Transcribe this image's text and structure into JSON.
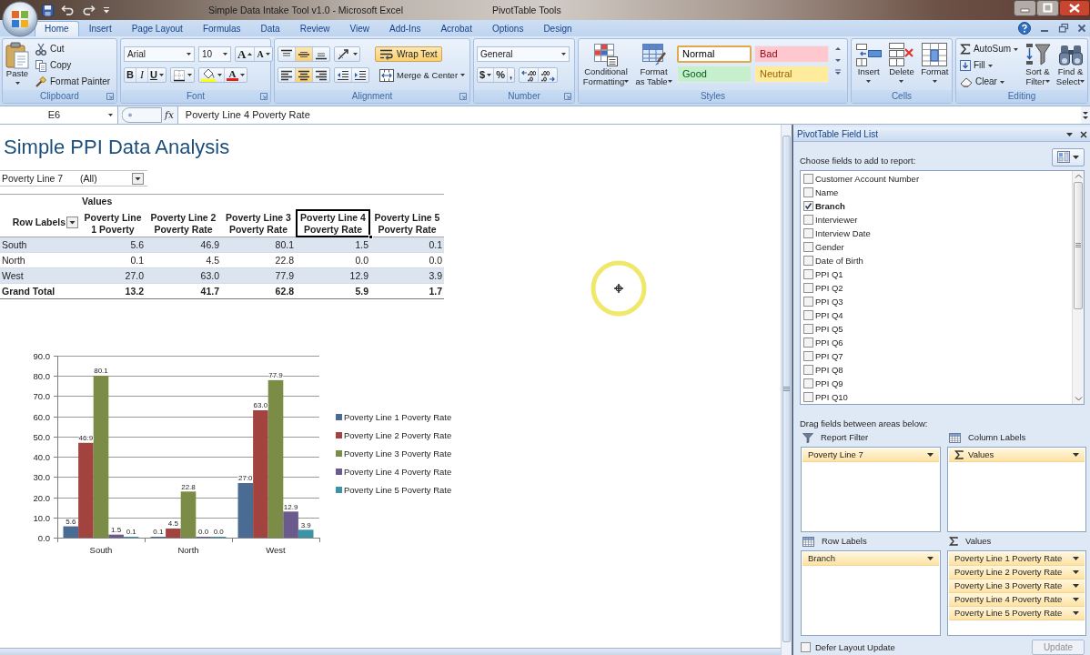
{
  "window": {
    "title": "Simple Data Intake Tool v1.0 - Microsoft Excel",
    "context_label": "PivotTable Tools"
  },
  "ribbon_tabs": [
    {
      "label": "Home",
      "selected": true
    },
    {
      "label": "Insert",
      "selected": false
    },
    {
      "label": "Page Layout",
      "selected": false
    },
    {
      "label": "Formulas",
      "selected": false
    },
    {
      "label": "Data",
      "selected": false
    },
    {
      "label": "Review",
      "selected": false
    },
    {
      "label": "View",
      "selected": false
    },
    {
      "label": "Add-Ins",
      "selected": false
    },
    {
      "label": "Acrobat",
      "selected": false
    },
    {
      "label": "Options",
      "selected": false
    },
    {
      "label": "Design",
      "selected": false
    }
  ],
  "ribbon": {
    "clipboard": {
      "label": "Clipboard",
      "paste": "Paste",
      "actions": [
        {
          "kind": "cut",
          "label": "Cut"
        },
        {
          "kind": "copy",
          "label": "Copy"
        },
        {
          "kind": "painter",
          "label": "Format Painter"
        }
      ]
    },
    "font": {
      "label": "Font",
      "font_name": "Arial",
      "font_size": "10",
      "size_buttons": [
        {
          "kind": "grow",
          "glyph": "A"
        },
        {
          "kind": "shrink",
          "glyph": "A"
        }
      ],
      "style_buttons": [
        {
          "kind": "bold",
          "glyph": "B"
        },
        {
          "kind": "italic",
          "glyph": "I"
        },
        {
          "kind": "underline",
          "glyph": "U"
        }
      ],
      "color_glyph": "A"
    },
    "alignment": {
      "label": "Alignment",
      "vertical": [
        {
          "kind": "top",
          "selected": false
        },
        {
          "kind": "middle",
          "selected": true
        },
        {
          "kind": "bottom",
          "selected": false
        }
      ],
      "horizontal": [
        {
          "kind": "left",
          "selected": false
        },
        {
          "kind": "center",
          "selected": true
        },
        {
          "kind": "right",
          "selected": false
        }
      ],
      "wrap_text": {
        "label": "Wrap Text",
        "selected": true
      },
      "merge": "Merge & Center"
    },
    "number": {
      "label": "Number",
      "format": "General",
      "symbols": [
        {
          "kind": "currency",
          "glyph": "$"
        },
        {
          "kind": "percent",
          "glyph": "%"
        },
        {
          "kind": "comma",
          "glyph": ","
        }
      ]
    },
    "styles": {
      "label": "Styles",
      "big_buttons": [
        {
          "kind": "conditional",
          "label": "Conditional\nFormatting"
        },
        {
          "kind": "table",
          "label": "Format\nas Table"
        }
      ],
      "gallery": [
        {
          "label": "Normal",
          "color": "#ffffff",
          "selected": true
        },
        {
          "label": "Bad",
          "color": "#ffc7ce",
          "selected": false
        },
        {
          "label": "Good",
          "color": "#c6efce",
          "selected": false
        },
        {
          "label": "Neutral",
          "color": "#ffeb9c",
          "selected": false
        }
      ]
    },
    "cells": {
      "label": "Cells",
      "buttons": [
        {
          "kind": "insert",
          "label": "Insert"
        },
        {
          "kind": "delete",
          "label": "Delete"
        },
        {
          "kind": "format",
          "label": "Format"
        }
      ]
    },
    "editing": {
      "label": "Editing",
      "small": [
        {
          "kind": "autosum",
          "label": "AutoSum"
        },
        {
          "kind": "fill",
          "label": "Fill"
        },
        {
          "kind": "clear",
          "label": "Clear"
        }
      ],
      "big": [
        {
          "kind": "sort",
          "label": "Sort &\nFilter"
        },
        {
          "kind": "find",
          "label": "Find &\nSelect"
        }
      ]
    }
  },
  "formula_bar": {
    "name_box": "E6",
    "function_glyph": "fx",
    "formula": "Poverty Line 4 Poverty Rate"
  },
  "sheet": {
    "title": "Simple PPI Data Analysis",
    "report_filter": {
      "field": "Poverty Line 7",
      "value": "(All)"
    },
    "pivot_table": {
      "values_caption": "Values",
      "row_header": "Row Labels",
      "columns": [
        {
          "label": "Poverty Line\n1 Poverty",
          "selected": false
        },
        {
          "label": "Poverty Line 2\nPoverty Rate",
          "selected": false
        },
        {
          "label": "Poverty Line 3\nPoverty Rate",
          "selected": false
        },
        {
          "label": "Poverty Line 4\nPoverty Rate",
          "selected": true
        },
        {
          "label": "Poverty Line 5\nPoverty Rate",
          "selected": false
        }
      ],
      "rows": [
        {
          "label": "South",
          "cells": [
            "5.6",
            "46.9",
            "80.1",
            "1.5",
            "0.1"
          ]
        },
        {
          "label": "North",
          "cells": [
            "0.1",
            "4.5",
            "22.8",
            "0.0",
            "0.0"
          ]
        },
        {
          "label": "West",
          "cells": [
            "27.0",
            "63.0",
            "77.9",
            "12.9",
            "3.9"
          ]
        }
      ],
      "grand_total": {
        "label": "Grand Total",
        "cells": [
          "13.2",
          "41.7",
          "62.8",
          "5.9",
          "1.7"
        ]
      }
    },
    "chart": {
      "chart_data": {
        "type": "bar",
        "categories": [
          "South",
          "North",
          "West"
        ],
        "series": [
          {
            "name": "Poverty Line 1 Poverty Rate",
            "color": "#4a6b93",
            "values": [
              5.6,
              0.1,
              27.0
            ],
            "value_labels": [
              "5.6",
              "0.1",
              "27.0"
            ]
          },
          {
            "name": "Poverty Line 2 Poverty Rate",
            "color": "#a3433f",
            "values": [
              46.9,
              4.5,
              63.0
            ],
            "value_labels": [
              "46.9",
              "4.5",
              "63.0"
            ]
          },
          {
            "name": "Poverty Line 3 Poverty Rate",
            "color": "#7b8c46",
            "values": [
              80.1,
              22.8,
              77.9
            ],
            "value_labels": [
              "80.1",
              "22.8",
              "77.9"
            ]
          },
          {
            "name": "Poverty Line 4 Poverty Rate",
            "color": "#6b5b8c",
            "values": [
              1.5,
              0.0,
              12.9
            ],
            "value_labels": [
              "1.5",
              "0.0",
              "12.9"
            ]
          },
          {
            "name": "Poverty Line 5 Poverty Rate",
            "color": "#3c93a8",
            "values": [
              0.1,
              0.0,
              3.9
            ],
            "value_labels": [
              "0.1",
              "0.0",
              "3.9"
            ]
          }
        ],
        "ylim": [
          0,
          90
        ],
        "yticks": [
          {
            "value": 0,
            "label": "0.0"
          },
          {
            "value": 10,
            "label": "10.0"
          },
          {
            "value": 20,
            "label": "20.0"
          },
          {
            "value": 30,
            "label": "30.0"
          },
          {
            "value": 40,
            "label": "40.0"
          },
          {
            "value": 50,
            "label": "50.0"
          },
          {
            "value": 60,
            "label": "60.0"
          },
          {
            "value": 70,
            "label": "70.0"
          },
          {
            "value": 80,
            "label": "80.0"
          },
          {
            "value": 90,
            "label": "90.0"
          }
        ],
        "grid": true,
        "legend": "right",
        "data_labels": true
      }
    }
  },
  "field_list": {
    "title": "PivotTable Field List",
    "prompt": "Choose fields to add to report:",
    "fields": [
      {
        "label": "Customer Account Number",
        "checked": false
      },
      {
        "label": "Name",
        "checked": false
      },
      {
        "label": "Branch",
        "checked": true
      },
      {
        "label": "Interviewer",
        "checked": false
      },
      {
        "label": "Interview Date",
        "checked": false
      },
      {
        "label": "Gender",
        "checked": false
      },
      {
        "label": "Date of Birth",
        "checked": false
      },
      {
        "label": "PPI Q1",
        "checked": false
      },
      {
        "label": "PPI Q2",
        "checked": false
      },
      {
        "label": "PPI Q3",
        "checked": false
      },
      {
        "label": "PPI Q4",
        "checked": false
      },
      {
        "label": "PPI Q5",
        "checked": false
      },
      {
        "label": "PPI Q6",
        "checked": false
      },
      {
        "label": "PPI Q7",
        "checked": false
      },
      {
        "label": "PPI Q8",
        "checked": false
      },
      {
        "label": "PPI Q9",
        "checked": false
      },
      {
        "label": "PPI Q10",
        "checked": false
      }
    ],
    "areas_prompt": "Drag fields between areas below:",
    "areas": [
      {
        "kind": "filter",
        "label": "Report Filter",
        "items": [
          {
            "kind": "field",
            "label": "Poverty Line 7"
          }
        ]
      },
      {
        "kind": "columns",
        "label": "Column Labels",
        "items": [
          {
            "kind": "values",
            "label": "Values"
          }
        ]
      },
      {
        "kind": "rows",
        "label": "Row Labels",
        "items": [
          {
            "kind": "field",
            "label": "Branch"
          }
        ]
      },
      {
        "kind": "values",
        "label": "Values",
        "items": [
          {
            "kind": "field",
            "label": "Poverty Line 1 Poverty Rate"
          },
          {
            "kind": "field",
            "label": "Poverty Line 2 Poverty Rate"
          },
          {
            "kind": "field",
            "label": "Poverty Line 3 Poverty Rate"
          },
          {
            "kind": "field",
            "label": "Poverty Line 4 Poverty Rate"
          },
          {
            "kind": "field",
            "label": "Poverty Line 5 Poverty Rate"
          }
        ]
      }
    ],
    "defer_update": {
      "label": "Defer Layout Update",
      "checked": false
    },
    "update_button": {
      "label": "Update",
      "disabled": true
    }
  }
}
